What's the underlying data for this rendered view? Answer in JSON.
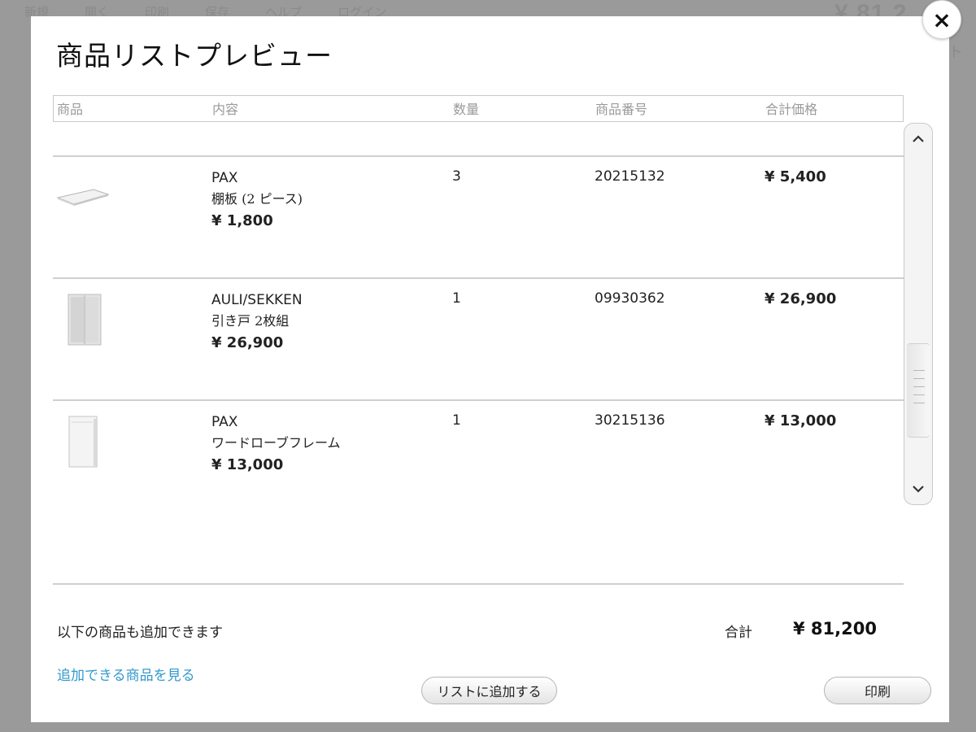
{
  "background": {
    "menu": [
      "新規",
      "開く",
      "印刷",
      "保存",
      "ヘルプ",
      "ログイン"
    ],
    "total": "¥ 81,2",
    "side_text": "ト"
  },
  "modal": {
    "title": "商品リストプレビュー",
    "close_label": "×"
  },
  "table": {
    "headers": [
      "商品",
      "内容",
      "数量",
      "商品番号",
      "合計価格"
    ],
    "rows": [
      {
        "name": "PAX",
        "desc": "棚板 (2 ピース)",
        "unit_price": "¥ 1,800",
        "qty": "3",
        "code": "20215132",
        "total": "¥ 5,400"
      },
      {
        "name": "AULI/SEKKEN",
        "desc": "引き戸 2枚組",
        "unit_price": "¥ 26,900",
        "qty": "1",
        "code": "09930362",
        "total": "¥ 26,900"
      },
      {
        "name": "PAX",
        "desc": "ワードローブフレーム",
        "unit_price": "¥ 13,000",
        "qty": "1",
        "code": "30215136",
        "total": "¥ 13,000"
      }
    ]
  },
  "footer": {
    "addable_text": "以下の商品も追加できます",
    "addable_link": "追加できる商品を見る",
    "sum_label": "合計",
    "sum_value": "¥ 81,200",
    "add_button": "リストに追加する",
    "print_button": "印刷"
  },
  "colors": {
    "link": "#3399cc",
    "overlay": "#9a9a9a"
  },
  "icons": {
    "close": "close-icon",
    "scroll_up": "chevron-up-icon",
    "scroll_down": "chevron-down-icon"
  }
}
